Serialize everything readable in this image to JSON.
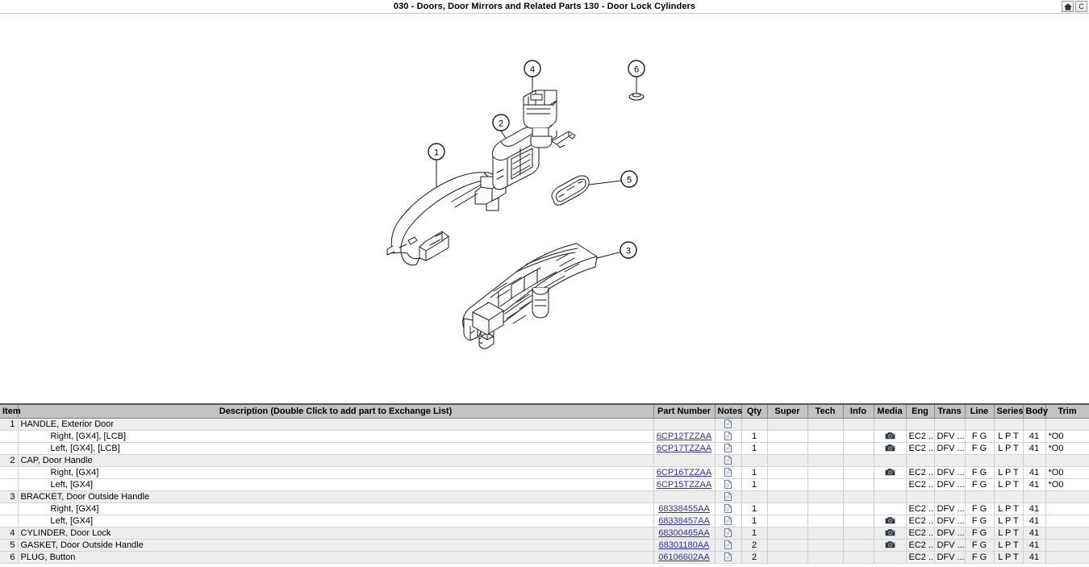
{
  "titlebar": {
    "title": "030 - Doors, Door Mirrors and Related Parts 130 - Door Lock Cylinders",
    "buttons": [
      {
        "name": "home-button",
        "icon": "home-icon",
        "label": ""
      },
      {
        "name": "catalog-button",
        "icon": "letter-c-icon",
        "label": "C"
      }
    ]
  },
  "illustration": {
    "callouts": [
      {
        "id": "1",
        "label": "1"
      },
      {
        "id": "2",
        "label": "2"
      },
      {
        "id": "3",
        "label": "3"
      },
      {
        "id": "4",
        "label": "4"
      },
      {
        "id": "5",
        "label": "5"
      },
      {
        "id": "6",
        "label": "6"
      }
    ],
    "line_color": "#1a1a1a",
    "fill_color": "#fdfdfd"
  },
  "table": {
    "columns": [
      {
        "key": "item",
        "label": "Item"
      },
      {
        "key": "desc",
        "label": "Description (Double Click to add part to Exchange List)"
      },
      {
        "key": "part",
        "label": "Part Number"
      },
      {
        "key": "notes",
        "label": "Notes"
      },
      {
        "key": "qty",
        "label": "Qty"
      },
      {
        "key": "super",
        "label": "Super"
      },
      {
        "key": "tech",
        "label": "Tech"
      },
      {
        "key": "info",
        "label": "Info"
      },
      {
        "key": "media",
        "label": "Media"
      },
      {
        "key": "eng",
        "label": "Eng"
      },
      {
        "key": "trans",
        "label": "Trans"
      },
      {
        "key": "line",
        "label": "Line"
      },
      {
        "key": "series",
        "label": "Series"
      },
      {
        "key": "body",
        "label": "Body"
      },
      {
        "key": "trim",
        "label": "Trim"
      }
    ],
    "rows": [
      {
        "kind": "main",
        "item": "1",
        "desc": "HANDLE, Exterior Door",
        "indent": false,
        "part": "",
        "notes": "note-icon",
        "qty": "",
        "super": "",
        "tech": "",
        "info": "",
        "media": "",
        "eng": "",
        "trans": "",
        "line": "",
        "series": "",
        "body": "",
        "trim": ""
      },
      {
        "kind": "sub",
        "item": "",
        "desc": "Right, [GX4], [LCB]",
        "indent": true,
        "part": "6CP12TZZAA",
        "notes": "note-icon",
        "qty": "1",
        "super": "",
        "tech": "",
        "info": "",
        "media": "camera-icon",
        "eng": "EC2 ...",
        "trans": "DFV ...",
        "line": "F G",
        "series": "L P T",
        "body": "41",
        "trim": "*O0"
      },
      {
        "kind": "sub",
        "item": "",
        "desc": "Left, [GX4], [LCB]",
        "indent": true,
        "part": "6CP17TZZAA",
        "notes": "note-icon",
        "qty": "1",
        "super": "",
        "tech": "",
        "info": "",
        "media": "camera-icon",
        "eng": "EC2 ...",
        "trans": "DFV ...",
        "line": "F G",
        "series": "L P T",
        "body": "41",
        "trim": "*O0"
      },
      {
        "kind": "main",
        "item": "2",
        "desc": "CAP, Door Handle",
        "indent": false,
        "part": "",
        "notes": "note-icon",
        "qty": "",
        "super": "",
        "tech": "",
        "info": "",
        "media": "",
        "eng": "",
        "trans": "",
        "line": "",
        "series": "",
        "body": "",
        "trim": ""
      },
      {
        "kind": "sub",
        "item": "",
        "desc": "Right, [GX4]",
        "indent": true,
        "part": "6CP16TZZAA",
        "notes": "note-icon",
        "qty": "1",
        "super": "",
        "tech": "",
        "info": "",
        "media": "camera-icon",
        "eng": "EC2 ...",
        "trans": "DFV ...",
        "line": "F G",
        "series": "L P T",
        "body": "41",
        "trim": "*O0"
      },
      {
        "kind": "sub",
        "item": "",
        "desc": "Left, [GX4]",
        "indent": true,
        "part": "6CP15TZZAA",
        "notes": "note-icon",
        "qty": "1",
        "super": "",
        "tech": "",
        "info": "",
        "media": "",
        "eng": "EC2 ...",
        "trans": "DFV ...",
        "line": "F G",
        "series": "L P T",
        "body": "41",
        "trim": "*O0"
      },
      {
        "kind": "main",
        "item": "3",
        "desc": "BRACKET, Door Outside Handle",
        "indent": false,
        "part": "",
        "notes": "note-icon",
        "qty": "",
        "super": "",
        "tech": "",
        "info": "",
        "media": "",
        "eng": "",
        "trans": "",
        "line": "",
        "series": "",
        "body": "",
        "trim": ""
      },
      {
        "kind": "sub",
        "item": "",
        "desc": "Right, [GX4]",
        "indent": true,
        "part": "68338455AA",
        "notes": "note-icon",
        "qty": "1",
        "super": "",
        "tech": "",
        "info": "",
        "media": "",
        "eng": "EC2 ...",
        "trans": "DFV ...",
        "line": "F G",
        "series": "L P T",
        "body": "41",
        "trim": ""
      },
      {
        "kind": "sub",
        "item": "",
        "desc": "Left, [GX4]",
        "indent": true,
        "part": "68338457AA",
        "notes": "note-icon",
        "qty": "1",
        "super": "",
        "tech": "",
        "info": "",
        "media": "camera-icon",
        "eng": "EC2 ...",
        "trans": "DFV ...",
        "line": "F G",
        "series": "L P T",
        "body": "41",
        "trim": ""
      },
      {
        "kind": "main",
        "item": "4",
        "desc": "CYLINDER, Door Lock",
        "indent": false,
        "part": "68300465AA",
        "notes": "note-icon",
        "qty": "1",
        "super": "",
        "tech": "",
        "info": "",
        "media": "camera-icon",
        "eng": "EC2 ...",
        "trans": "DFV ...",
        "line": "F G",
        "series": "L P T",
        "body": "41",
        "trim": ""
      },
      {
        "kind": "main",
        "item": "5",
        "desc": "GASKET, Door Outside Handle",
        "indent": false,
        "part": "68301180AA",
        "notes": "note-icon",
        "qty": "2",
        "super": "",
        "tech": "",
        "info": "",
        "media": "camera-icon",
        "eng": "EC2 ...",
        "trans": "DFV ...",
        "line": "F G",
        "series": "L P T",
        "body": "41",
        "trim": ""
      },
      {
        "kind": "main",
        "item": "6",
        "desc": "PLUG, Button",
        "indent": false,
        "part": "06106602AA",
        "notes": "note-icon",
        "qty": "2",
        "super": "",
        "tech": "",
        "info": "",
        "media": "",
        "eng": "EC2 ...",
        "trans": "DFV ...",
        "line": "F G",
        "series": "L P T",
        "body": "41",
        "trim": ""
      }
    ]
  }
}
